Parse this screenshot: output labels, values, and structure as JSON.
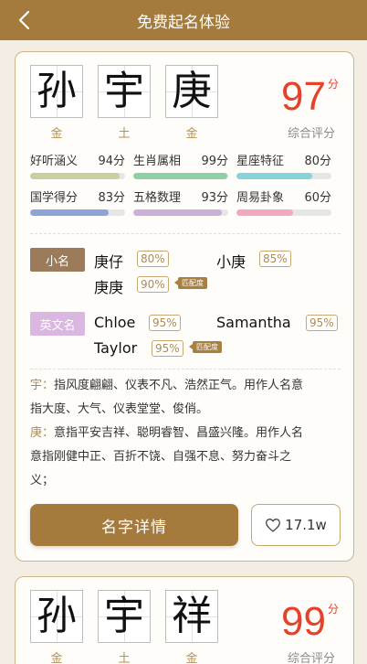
{
  "header": {
    "title": "免费起名体验"
  },
  "cards": [
    {
      "chars": [
        {
          "ch": "孙",
          "element": "金"
        },
        {
          "ch": "宇",
          "element": "土"
        },
        {
          "ch": "庚",
          "element": "金"
        }
      ],
      "score": "97",
      "score_unit": "分",
      "score_label": "综合评分",
      "metrics": [
        {
          "label": "好听涵义",
          "value": "94分",
          "pct": 94,
          "color": "#c9cf9e"
        },
        {
          "label": "生肖属相",
          "value": "99分",
          "pct": 99,
          "color": "#8dd0a6"
        },
        {
          "label": "星座特征",
          "value": "80分",
          "pct": 80,
          "color": "#86d4da"
        },
        {
          "label": "国学得分",
          "value": "83分",
          "pct": 83,
          "color": "#8ea3d6"
        },
        {
          "label": "五格数理",
          "value": "93分",
          "pct": 93,
          "color": "#cbb0d9"
        },
        {
          "label": "周易卦象",
          "value": "60分",
          "pct": 60,
          "color": "#f2a9bd"
        }
      ],
      "nicknames": {
        "tag": "小名",
        "items": [
          {
            "name": "庚仔",
            "pct": "80%"
          },
          {
            "name": "小庚",
            "pct": "85%"
          },
          {
            "name": "庚庚",
            "pct": "90%",
            "badge": "匹配度"
          }
        ]
      },
      "english": {
        "tag": "英文名",
        "items": [
          {
            "name": "Chloe",
            "pct": "95%"
          },
          {
            "name": "Samantha",
            "pct": "95%"
          },
          {
            "name": "Taylor",
            "pct": "95%",
            "badge": "匹配度"
          }
        ]
      },
      "desc": [
        {
          "key": "宇：",
          "lines": [
            "指风度翩翩、仪表不凡、浩然正气。用作人名意",
            "指大度、大气、仪表堂堂、俊俏。"
          ]
        },
        {
          "key": "庚：",
          "lines": [
            "意指平安吉祥、聪明睿智、昌盛兴隆。用作人名",
            "意指刚健中正、百折不饶、自强不息、努力奋斗之",
            "义；"
          ]
        }
      ],
      "detail_button": "名字详情",
      "likes": "17.1w"
    },
    {
      "chars": [
        {
          "ch": "孙",
          "element": "金"
        },
        {
          "ch": "宇",
          "element": "土"
        },
        {
          "ch": "祥",
          "element": "金"
        }
      ],
      "score": "99",
      "score_unit": "分",
      "score_label": "综合评分"
    }
  ]
}
